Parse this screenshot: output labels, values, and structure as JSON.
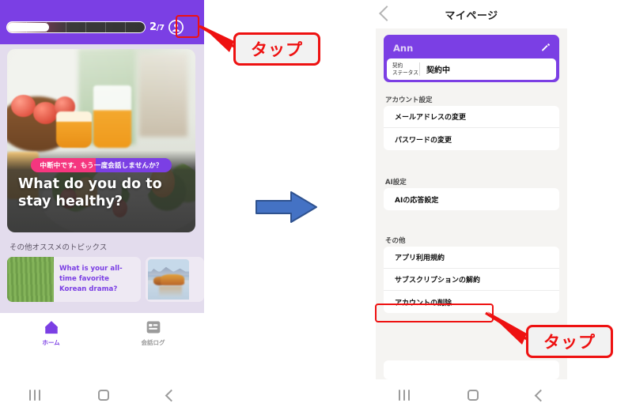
{
  "left_phone": {
    "progress": {
      "current": "2",
      "separator": "/",
      "total": "7",
      "percent": 28,
      "segments": 7
    },
    "avatar_icon": "account-circle-icon",
    "hero": {
      "badge": "中断中です。もう一度会話しませんか？",
      "title": "What do you do to stay healthy?",
      "image_desc": "salad-and-orange-juice-photo"
    },
    "topics_heading": "その他オススメのトピックス",
    "topics": [
      {
        "title": "What is your all-time favorite Korean drama?",
        "thumb": "grass-field-thumbnail"
      },
      {
        "title": "",
        "thumb": "mountain-lake-thumbnail"
      }
    ],
    "bottom_nav": [
      {
        "label": "ホーム",
        "icon": "home-icon",
        "active": true
      },
      {
        "label": "会話ログ",
        "icon": "conversation-log-icon",
        "active": false
      }
    ],
    "android_nav": [
      "recents-icon",
      "home-icon",
      "back-icon"
    ]
  },
  "right_phone": {
    "header": {
      "back_icon": "back-arrow-icon",
      "title": "マイページ"
    },
    "profile": {
      "name": "Ann",
      "edit_icon": "pencil-icon",
      "status_label": "契約\nステータス",
      "status_label_line1": "契約",
      "status_label_line2": "ステータス",
      "status_value": "契約中"
    },
    "sections": [
      {
        "heading": "アカウント設定",
        "items": [
          {
            "label": "メールアドレスの変更",
            "highlighted": false
          },
          {
            "label": "パスワードの変更",
            "highlighted": false
          }
        ]
      },
      {
        "heading": "AI設定",
        "items": [
          {
            "label": "AIの応答設定",
            "highlighted": false
          }
        ]
      },
      {
        "heading": "その他",
        "items": [
          {
            "label": "アプリ利用規約",
            "highlighted": false
          },
          {
            "label": "サブスクリプションの解約",
            "highlighted": true
          },
          {
            "label": "アカウントの削除",
            "highlighted": false
          }
        ]
      }
    ],
    "android_nav": [
      "recents-icon",
      "home-icon",
      "back-icon"
    ]
  },
  "annotations": {
    "callout_1": "タップ",
    "callout_2": "タップ",
    "flow_arrow": "blue-right-arrow",
    "highlight_color": "#ee1111",
    "arrow_color": "#4472c4",
    "brand_purple": "#7b3fe4"
  }
}
